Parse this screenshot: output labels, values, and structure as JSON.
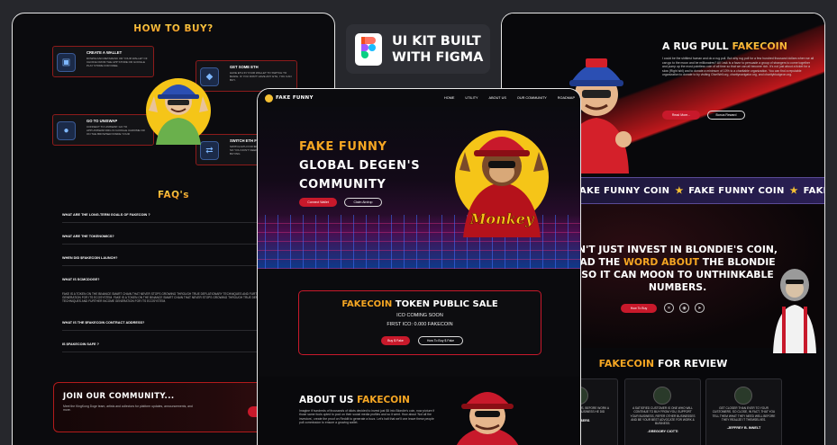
{
  "left": {
    "how_to_buy_title": "HOW TO BUY?",
    "steps": [
      {
        "title": "CREATE A WALLET",
        "desc": "DOWNLOAD METAMASK OR YOUR WALLET OF CHOICE FROM THE APP STORE OR GOOGLE PLAY STORE FOR FREE."
      },
      {
        "title": "GET SOME ETH",
        "desc": "HAVE ETH IN YOUR WALLET TO SWITCH TO $FAKE. IF YOU DON'T HAVE ANY ETH, YOU CAN BUY."
      },
      {
        "title": "GO TO UNISWAP",
        "desc": "CONNECT TO UNISWAP. GO TO APP.UNISWAP.ORG IN GOOGLE CHROME OR ON THE BROWSER INSIDE YOUR"
      },
      {
        "title": "SWITCH ETH FO",
        "desc": "SWITCH ETH FOR $FAKE. WE HAVE NO TAXES SO YOU DON'T NEED TO WORRY ABOUT BUYING"
      }
    ],
    "faq_title": "FAQ's",
    "faqs": [
      "WHAT ARE THE LONG-TERM GOALS OF FAKECOIN ?",
      "WHAT ARE THE TOKENOMICS?",
      "WHEN DID $FAKECOIN LAUNCH?",
      "WHAT IS SCMCDOGE?",
      "WHAT IS THE $FAKECOIN CONTRACT ADDRESS?",
      "IS $FAKECOIN SAFE ?"
    ],
    "faq_answer": "FAKE IS A TOKEN ON THE BINANCE SMART CHAIN THAT NEVER STOPS GROWING THROUGH TRUE DEFLATIONARY TECHNIQUES AND FURTHER INCOME GENERATION FOR ITS ECOSYSTEM. FAKE IS A TOKEN ON THE BINANCE SMART CHAIN THAT NEVER STOPS GROWING THROUGH TRUE DEFLATIONARY TECHNIQUES AND FURTHER INCOME GENERATION FOR ITS ECOSYSTEM.",
    "community_title": "JOIN OUR COMMUNITY...",
    "community_desc": "Meet the KingKong Doge team, artists and collectors for platform updates, announcements, and more.",
    "community_btn": "Jo"
  },
  "badge": {
    "line1": "UI KIT BUILT",
    "line2": "WITH FIGMA"
  },
  "right": {
    "rug_title_white": "A RUG PULL ",
    "rug_title_gold": "FAKECOIN",
    "rug_text": "I could be the shittiest human and do a rug pull. But why rug pull for a few hundred thousand dollars when we all can go to the moon and be millionaires? All I ask is a favor to persuade a group of strangers to come together and pump up the most pointless coin of all time so that we can all become rich. It's not just about a ticket for a slow (Right ishl) and to donate a minimum of 10% to a charitable organization. You can find a reputable organization to donate to by visiting GiveWell.org, charitynavigator.org, and charitybludgeon.org.",
    "read_more": "Read More...",
    "bonus_reward": "Bonus Reward",
    "ticker": [
      "FAKE FUNNY COIN",
      "FAKE FUNNY COIN",
      "FAKE FUNNY"
    ],
    "hero_line1": "N'T JUST INVEST IN BLONDIE'S COIN,",
    "hero_line2a": "AD THE ",
    "hero_line2b": "WORD ABOUT",
    "hero_line2c": " THE BLONDIE",
    "hero_line3": "SO IT CAN MOON TO UNTHINKABLE",
    "hero_line4": "NUMBERS.",
    "how_to_btn": "How To Buy",
    "review_white": " FOR REVIEW",
    "review_gold": "FAKECOIN",
    "reviews": [
      {
        "text": "MY HUSBAND, HE PLUS, BEFORE WORK A WHILE OUR OWN BUSINESS HE DID",
        "name": "CHAMBERS"
      },
      {
        "text": "A SATISFIED CUSTOMER IS ONE WHO WILL CONTINUE TO BUY FROM YOU, SUPPORT YOUR BUSINESS, REFER OTHER BUSINESSES AND BE YOUR BEST ADVOCATE FOR WORK & BUSINESS.",
        "name": "-GREGORY CIOTTI"
      },
      {
        "text": "GET CLOSER THAN EVER TO YOUR CUSTOMERS. SO CLOSE, IN FACT, THAT YOU TELL THEM WHAT THEY NEED WELL BEFORE THEY REALIZE IT THEMSELVES.",
        "name": "-JEFFREY B. INNELT"
      }
    ]
  },
  "center": {
    "brand": "FAKE FUNNY",
    "nav": [
      "HOME",
      "UTILITY",
      "ABOUT US",
      "OUR COMMUNITY",
      "ROADMAP"
    ],
    "hero_l1": "FAKE FUNNY",
    "hero_l2": "GLOBAL DEGEN'S",
    "hero_l3": "COMMUNITY",
    "connect_wallet": "Connect Wallet",
    "claim_airdrop": "Claim Airdrop",
    "sale_gold": "FAKECOIN",
    "sale_white": " TOKEN PUBLIC SALE",
    "ico_coming": "ICO COMING SOON",
    "first_ico": "FIRST ICO: 0.000 FAKECOIN",
    "buy_btn": "Buy $ Fake",
    "how_btn": "How To Buy $ Fake",
    "about_white": "ABOUT US ",
    "about_gold": "FAKECOIN",
    "about_text": "Imagine if hundreds of thousands of idiots decided to invest just $5 into Blondie's coin, now picture if those same fools opted to pool on their social media profiles and so it went. How about 'Not all the investors', create the proof on Reddit to generate a buzz. Let's halt that we'll one leave these people pull commission to ensure a growing wallet.",
    "mascot_caption": "Monkey"
  }
}
